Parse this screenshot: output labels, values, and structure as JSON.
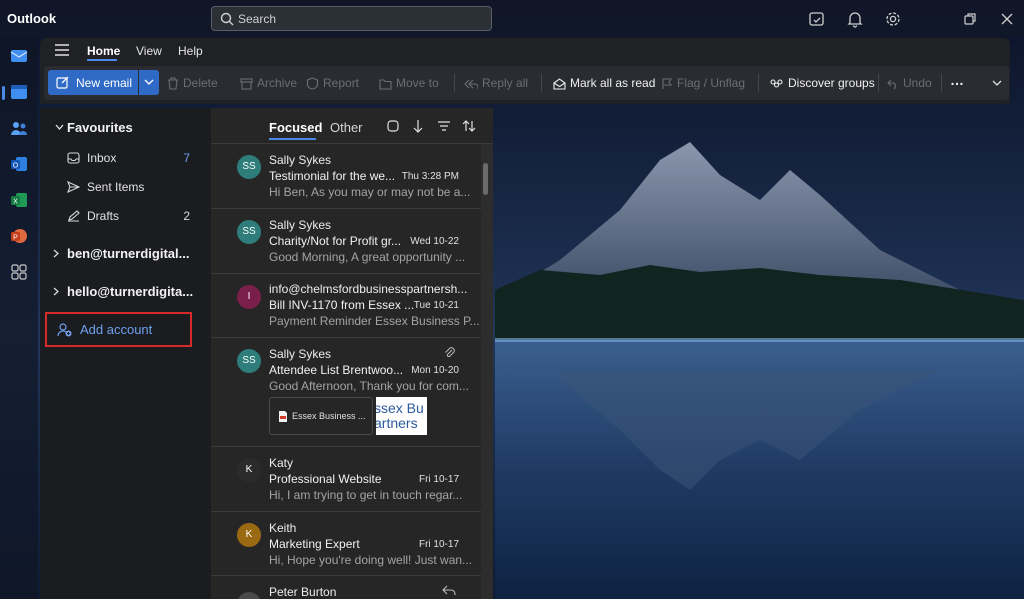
{
  "app": {
    "title": "Outlook"
  },
  "search": {
    "placeholder": "Search"
  },
  "menu": {
    "tabs": [
      "Home",
      "View",
      "Help"
    ],
    "active": "Home"
  },
  "toolbar": {
    "new_email": "New email",
    "delete": "Delete",
    "archive": "Archive",
    "report": "Report",
    "move_to": "Move to",
    "reply_all": "Reply all",
    "mark_all_read": "Mark all as read",
    "flag": "Flag / Unflag",
    "discover_groups": "Discover groups",
    "undo": "Undo",
    "more": "…"
  },
  "folders": {
    "favourites": "Favourites",
    "items": [
      {
        "label": "Inbox",
        "count": "7"
      },
      {
        "label": "Sent Items",
        "count": ""
      },
      {
        "label": "Drafts",
        "count": "2"
      }
    ],
    "accounts": [
      "ben@turnerdigital...",
      "hello@turnerdigita..."
    ],
    "add_account": "Add account"
  },
  "list": {
    "tab_focused": "Focused",
    "tab_other": "Other",
    "messages": [
      {
        "initials": "SS",
        "color": "#2e7d7a",
        "sender": "Sally Sykes",
        "subject": "Testimonial for the we...",
        "date": "Thu 3:28 PM",
        "preview": "Hi Ben, As you may or may not be a..."
      },
      {
        "initials": "SS",
        "color": "#2e7d7a",
        "sender": "Sally Sykes",
        "subject": "Charity/Not for Profit gr...",
        "date": "Wed 10-22",
        "preview": "Good Morning, A great opportunity ..."
      },
      {
        "initials": "I",
        "color": "#7a1f4a",
        "sender": "info@chelmsfordbusinesspartnersh...",
        "subject": "Bill INV-1170 from Essex ...",
        "date": "Tue 10-21",
        "preview": "Payment Reminder Essex Business P..."
      },
      {
        "initials": "SS",
        "color": "#2e7d7a",
        "sender": "Sally Sykes",
        "subject": "Attendee List Brentwoo...",
        "date": "Mon 10-20",
        "preview": "Good Afternoon, Thank you for com...",
        "attachment": "Essex Business ...",
        "thumb_lines": [
          "ssex Bu",
          "artners"
        ]
      },
      {
        "initials": "K",
        "color": "#2b2b2b",
        "sender": "Katy",
        "subject": "Professional Website",
        "date": "Fri 10-17",
        "preview": "Hi, I am trying to get in touch regar..."
      },
      {
        "initials": "K",
        "color": "#9a6a12",
        "sender": "Keith",
        "subject": "Marketing Expert",
        "date": "Fri 10-17",
        "preview": "Hi, Hope you're doing well! Just wan..."
      },
      {
        "initials": "PB",
        "color": "#4a4a4a",
        "sender": "Peter Burton",
        "subject": "",
        "date": "",
        "preview": ""
      }
    ]
  },
  "colors": {
    "accent": "#2f6bc6",
    "highlight_box": "#d72a2a",
    "link": "#6fa0ee"
  }
}
